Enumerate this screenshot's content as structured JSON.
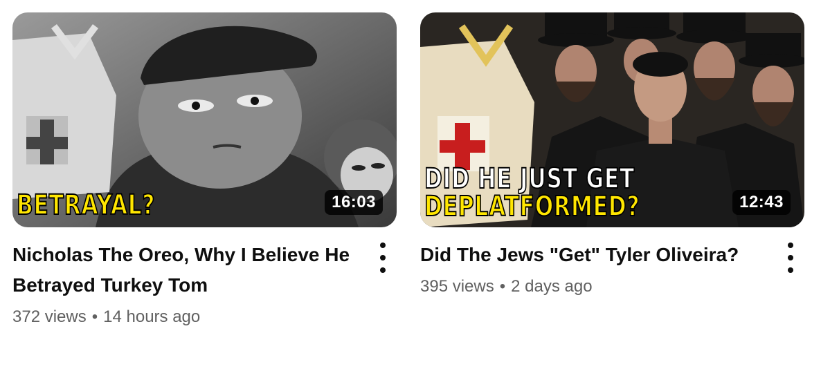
{
  "videos": [
    {
      "title": "Nicholas The Oreo, Why I Believe He Betrayed Turkey Tom",
      "views": "372 views",
      "age": "14 hours ago",
      "duration": "16:03",
      "thumbnail_text": [
        "BETRAYAL?"
      ],
      "icon": "more-vert-icon"
    },
    {
      "title": "Did The Jews \"Get\" Tyler Oliveira?",
      "views": "395 views",
      "age": "2 days ago",
      "duration": "12:43",
      "thumbnail_text": [
        "DID HE JUST GET",
        "DEPLATFORMED?"
      ],
      "icon": "more-vert-icon"
    }
  ],
  "separator": "•",
  "colors": {
    "thumb_text_white": "#ffffff",
    "thumb_text_yellow": "#ffe600",
    "meta_gray": "#606060"
  }
}
